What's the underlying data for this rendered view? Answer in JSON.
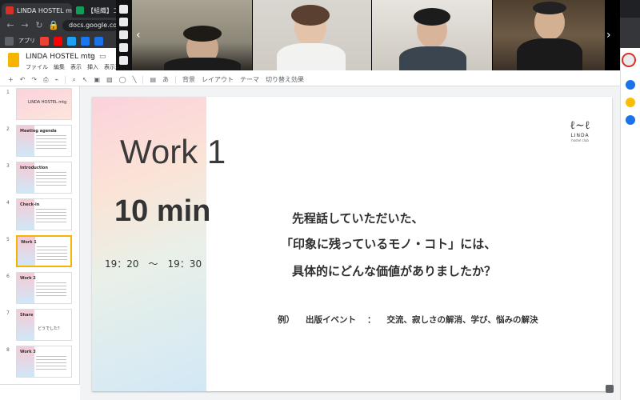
{
  "browser": {
    "tabs": [
      {
        "title": "LINDA HOSTEL mtg",
        "favicon_color": "#d93025"
      },
      {
        "title": "【組織】コミ",
        "favicon_color": "#0f9d58"
      }
    ],
    "url": "docs.google.com",
    "bookmarks_label": "アプリ"
  },
  "docs": {
    "title": "LINDA HOSTEL mtg",
    "menu": [
      "ファイル",
      "編集",
      "表示",
      "挿入",
      "表示形式"
    ]
  },
  "toolbar": {
    "background": "背景",
    "layout": "レイアウト",
    "theme": "テーマ",
    "transition": "切り替え効果"
  },
  "thumbnails": [
    {
      "num": "1",
      "title": "LINDA HOSTEL mtg",
      "active": false
    },
    {
      "num": "2",
      "title": "Meeting agenda",
      "active": false
    },
    {
      "num": "3",
      "title": "Introduction",
      "active": false
    },
    {
      "num": "4",
      "title": "Check-in",
      "active": false
    },
    {
      "num": "5",
      "title": "Work 1",
      "active": true
    },
    {
      "num": "6",
      "title": "Work 2",
      "active": false
    },
    {
      "num": "7",
      "title": "Share",
      "active": false
    },
    {
      "num": "8",
      "title": "Work 3",
      "active": false
    }
  ],
  "thumb7_body": "どうでした？",
  "slide": {
    "title": "Work 1",
    "duration": "10 min",
    "time_range": "19：20　～　19：30",
    "question_lines": [
      "先程話していただいた、",
      "「印象に残っているモノ・コト」には、",
      "具体的にどんな価値がありましたか？"
    ],
    "example_label": "例）",
    "example_event": "出版イベント",
    "example_sep": "：",
    "example_values": "交流、寂しさの解消、学び、悩みの解決",
    "brand_name": "LINDA",
    "brand_sub": "hostel club"
  },
  "colors": {
    "accent": "#f4b400",
    "gradient_pink": "#fbd2dc",
    "gradient_blue": "#d2e8f6"
  }
}
